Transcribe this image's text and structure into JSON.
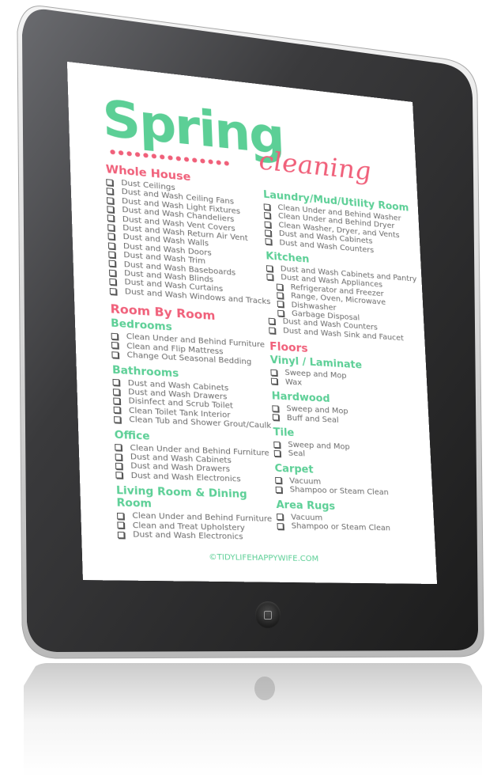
{
  "device": {
    "type": "tablet",
    "home_button_icon": "home-square-icon"
  },
  "colors": {
    "green": "#5ccf96",
    "pink": "#f0607a",
    "text": "#6b6b6b",
    "bezel": "#1e1e1e"
  },
  "document": {
    "title_main": "Spring",
    "title_script": "cleaning",
    "footer": "©TIDYLIFEHAPPYWIFE.COM",
    "left": {
      "whole_house": {
        "heading": "Whole House",
        "items": [
          "Dust Ceilings",
          "Dust and Wash Ceiling Fans",
          "Dust and Wash Light Fixtures",
          "Dust and Wash Chandeliers",
          "Dust and Wash Vent Covers",
          "Dust and Wash Return Air Vent",
          "Dust and Wash Walls",
          "Dust and Wash Doors",
          "Dust and Wash Trim",
          "Dust and Wash Baseboards",
          "Dust and Wash Blinds",
          "Dust and Wash Curtains",
          "Dust and Wash Windows and Tracks"
        ]
      },
      "room_by_room": {
        "heading": "Room By Room",
        "bedrooms": {
          "heading": "Bedrooms",
          "items": [
            "Clean Under and Behind Furniture",
            "Clean and Flip Mattress",
            "Change Out Seasonal Bedding"
          ]
        },
        "bathrooms": {
          "heading": "Bathrooms",
          "items": [
            "Dust and Wash Cabinets",
            "Dust and Wash Drawers",
            "Disinfect and Scrub Toilet",
            "Clean Toilet Tank Interior",
            "Clean Tub and Shower Grout/Caulk"
          ]
        },
        "office": {
          "heading": "Office",
          "items": [
            "Clean Under and Behind Furniture",
            "Dust and Wash Cabinets",
            "Dust and Wash Drawers",
            "Dust and Wash Electronics"
          ]
        },
        "living": {
          "heading": "Living Room & Dining Room",
          "items": [
            "Clean Under and Behind Furniture",
            "Clean and Treat Upholstery",
            "Dust and Wash Electronics"
          ]
        }
      }
    },
    "right": {
      "laundry": {
        "heading": "Laundry/Mud/Utility Room",
        "items": [
          "Clean Under and Behind Washer",
          "Clean Under and Behind Dryer",
          "Clean Washer, Dryer, and Vents",
          "Dust and Wash Cabinets",
          "Dust and Wash Counters"
        ]
      },
      "kitchen": {
        "heading": "Kitchen",
        "items": [
          {
            "label": "Dust and Wash Cabinets and Pantry",
            "sub": false
          },
          {
            "label": "Dust and Wash Appliances",
            "sub": false
          },
          {
            "label": "Refrigerator and Freezer",
            "sub": true
          },
          {
            "label": "Range, Oven, Microwave",
            "sub": true
          },
          {
            "label": "Dishwasher",
            "sub": true
          },
          {
            "label": "Garbage Disposal",
            "sub": true
          },
          {
            "label": "Dust and Wash Counters",
            "sub": false
          },
          {
            "label": "Dust and Wash Sink and Faucet",
            "sub": false
          }
        ]
      },
      "floors": {
        "heading": "Floors",
        "vinyl": {
          "heading": "Vinyl / Laminate",
          "items": [
            "Sweep and Mop",
            "Wax"
          ]
        },
        "hardwood": {
          "heading": "Hardwood",
          "items": [
            "Sweep and Mop",
            "Buff and Seal"
          ]
        },
        "tile": {
          "heading": "Tile",
          "items": [
            "Sweep and Mop",
            "Seal"
          ]
        },
        "carpet": {
          "heading": "Carpet",
          "items": [
            "Vacuum",
            "Shampoo or Steam Clean"
          ]
        },
        "rugs": {
          "heading": "Area Rugs",
          "items": [
            "Vacuum",
            "Shampoo or Steam Clean"
          ]
        }
      }
    }
  }
}
